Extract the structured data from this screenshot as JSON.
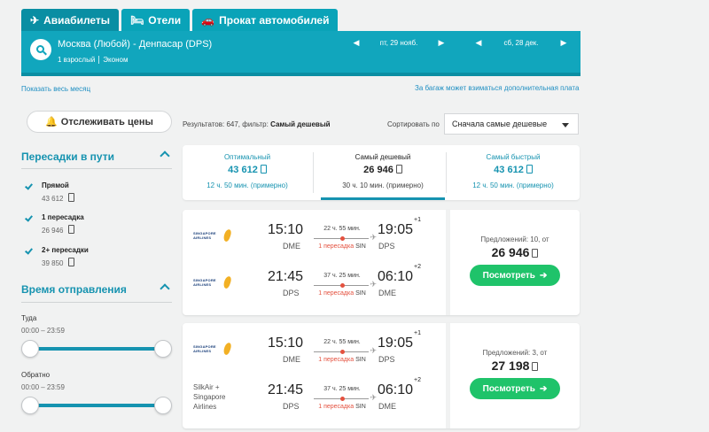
{
  "tabs": [
    {
      "label": "Авиабилеты",
      "icon": "plane-icon"
    },
    {
      "label": "Отели",
      "icon": "bed-icon"
    },
    {
      "label": "Прокат автомобилей",
      "icon": "car-icon"
    }
  ],
  "search": {
    "route": "Москва (Любой) - Денпасар (DPS)",
    "passengers": "1 взрослый",
    "cabin": "Эконом",
    "date_out": "пт, 29 нояб.",
    "date_back": "сб, 28 дек."
  },
  "links": {
    "show_month": "Показать весь месяц",
    "baggage_note": "За багаж может взиматься дополнительная плата"
  },
  "sidebar": {
    "track_prices": "Отслеживать цены",
    "stops_title": "Пересадки в пути",
    "stops": [
      {
        "label": "Прямой",
        "price": "43 612 ",
        "checked": true
      },
      {
        "label": "1 пересадка",
        "price": "26 946 ",
        "checked": true
      },
      {
        "label": "2+ пересадки",
        "price": "39 850 ",
        "checked": true
      }
    ],
    "departure_title": "Время отправления",
    "outbound_label": "Туда",
    "outbound_range": "00:00 – 23:59",
    "return_label": "Обратно",
    "return_range": "00:00 – 23:59"
  },
  "results": {
    "prefix": "Результатов: 647, фильтр: ",
    "filter": "Самый дешевый",
    "sort_label": "Сортировать по",
    "sort_value": "Сначала самые дешевые"
  },
  "sort_tabs": [
    {
      "title": "Оптимальный",
      "price": "43 612",
      "duration": "12 ч. 50 мин. (примерно)",
      "active": false
    },
    {
      "title": "Самый дешевый",
      "price": "26 946",
      "duration": "30 ч. 10 мин. (примерно)",
      "active": true
    },
    {
      "title": "Самый быстрый",
      "price": "43 612",
      "duration": "12 ч. 50 мин. (примерно)",
      "active": false
    }
  ],
  "tickets": [
    {
      "segments": [
        {
          "airline_logo": "SINGAPORE AIRLINES",
          "dep_time": "15:10",
          "dep_ap": "DME",
          "duration": "22 ч. 55 мин.",
          "stops": "1 пересадка",
          "via": "SIN",
          "arr_time": "19:05",
          "arr_ap": "DPS",
          "day_offset": "+1"
        },
        {
          "airline_logo": "SINGAPORE AIRLINES",
          "dep_time": "21:45",
          "dep_ap": "DPS",
          "duration": "37 ч. 25 мин.",
          "stops": "1 пересадка",
          "via": "SIN",
          "arr_time": "06:10",
          "arr_ap": "DME",
          "day_offset": "+2"
        }
      ],
      "offers": "Предложений: 10, от",
      "price": "26 946",
      "button": "Посмотреть"
    },
    {
      "segments": [
        {
          "airline_logo": "SINGAPORE AIRLINES",
          "dep_time": "15:10",
          "dep_ap": "DME",
          "duration": "22 ч. 55 мин.",
          "stops": "1 пересадка",
          "via": "SIN",
          "arr_time": "19:05",
          "arr_ap": "DPS",
          "day_offset": "+1"
        },
        {
          "airline_text": [
            "SilkAir +",
            "Singapore",
            "Airlines"
          ],
          "dep_time": "21:45",
          "dep_ap": "DPS",
          "duration": "37 ч. 25 мин.",
          "stops": "1 пересадка",
          "via": "SIN",
          "arr_time": "06:10",
          "arr_ap": "DME",
          "day_offset": "+2"
        }
      ],
      "offers": "Предложений: 3, от",
      "price": "27 198",
      "button": "Посмотреть"
    }
  ],
  "colors": {
    "teal": "#11a6bd",
    "link": "#1693b0",
    "green": "#1fc36a",
    "stop_red": "#e4513f"
  }
}
